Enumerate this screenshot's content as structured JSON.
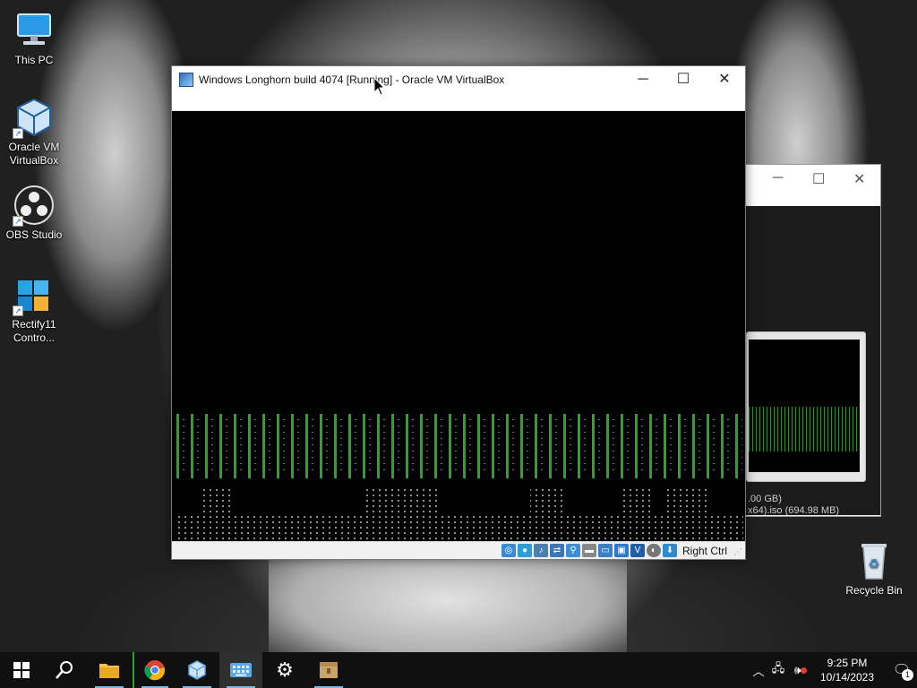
{
  "desktop": {
    "icons": [
      {
        "label": "This PC",
        "icon": "computer-icon"
      },
      {
        "label": "Oracle VM\nVirtualBox",
        "icon": "virtualbox-icon"
      },
      {
        "label": "OBS Studio",
        "icon": "obs-icon"
      },
      {
        "label": "Rectify11\nContro...",
        "icon": "control-panel-icon"
      }
    ],
    "recycle_bin": {
      "label": "Recycle Bin",
      "icon": "recycle-bin-icon"
    }
  },
  "vm_window": {
    "title": "Windows Longhorn build 4074 [Running] - Oracle VM VirtualBox",
    "controls": {
      "minimize": "─",
      "maximize": "☐",
      "close": "✕"
    },
    "status": {
      "host_key": "Right Ctrl"
    }
  },
  "bg_window": {
    "controls": {
      "minimize": "─",
      "maximize": "☐",
      "close": "✕"
    },
    "info_line1": ".00 GB)",
    "info_line2": "x64).iso (694.98 MB)"
  },
  "taskbar": {
    "clock_time": "9:25 PM",
    "clock_date": "10/14/2023",
    "notification_count": "1",
    "apps": [
      {
        "name": "start-button",
        "icon": "windows-logo-icon"
      },
      {
        "name": "search-button",
        "icon": "search-icon"
      },
      {
        "name": "file-explorer",
        "icon": "folder-icon"
      },
      {
        "name": "chrome",
        "icon": "chrome-icon"
      },
      {
        "name": "virtualbox",
        "icon": "virtualbox-icon"
      },
      {
        "name": "on-screen-keyboard",
        "icon": "keyboard-icon"
      },
      {
        "name": "settings",
        "icon": "gear-icon"
      },
      {
        "name": "package-app",
        "icon": "package-icon"
      }
    ]
  },
  "colors": {
    "vm_bar_green": "#2ea22e",
    "taskbar_bg": "#101010",
    "running_indicator": "#76b9ed"
  }
}
